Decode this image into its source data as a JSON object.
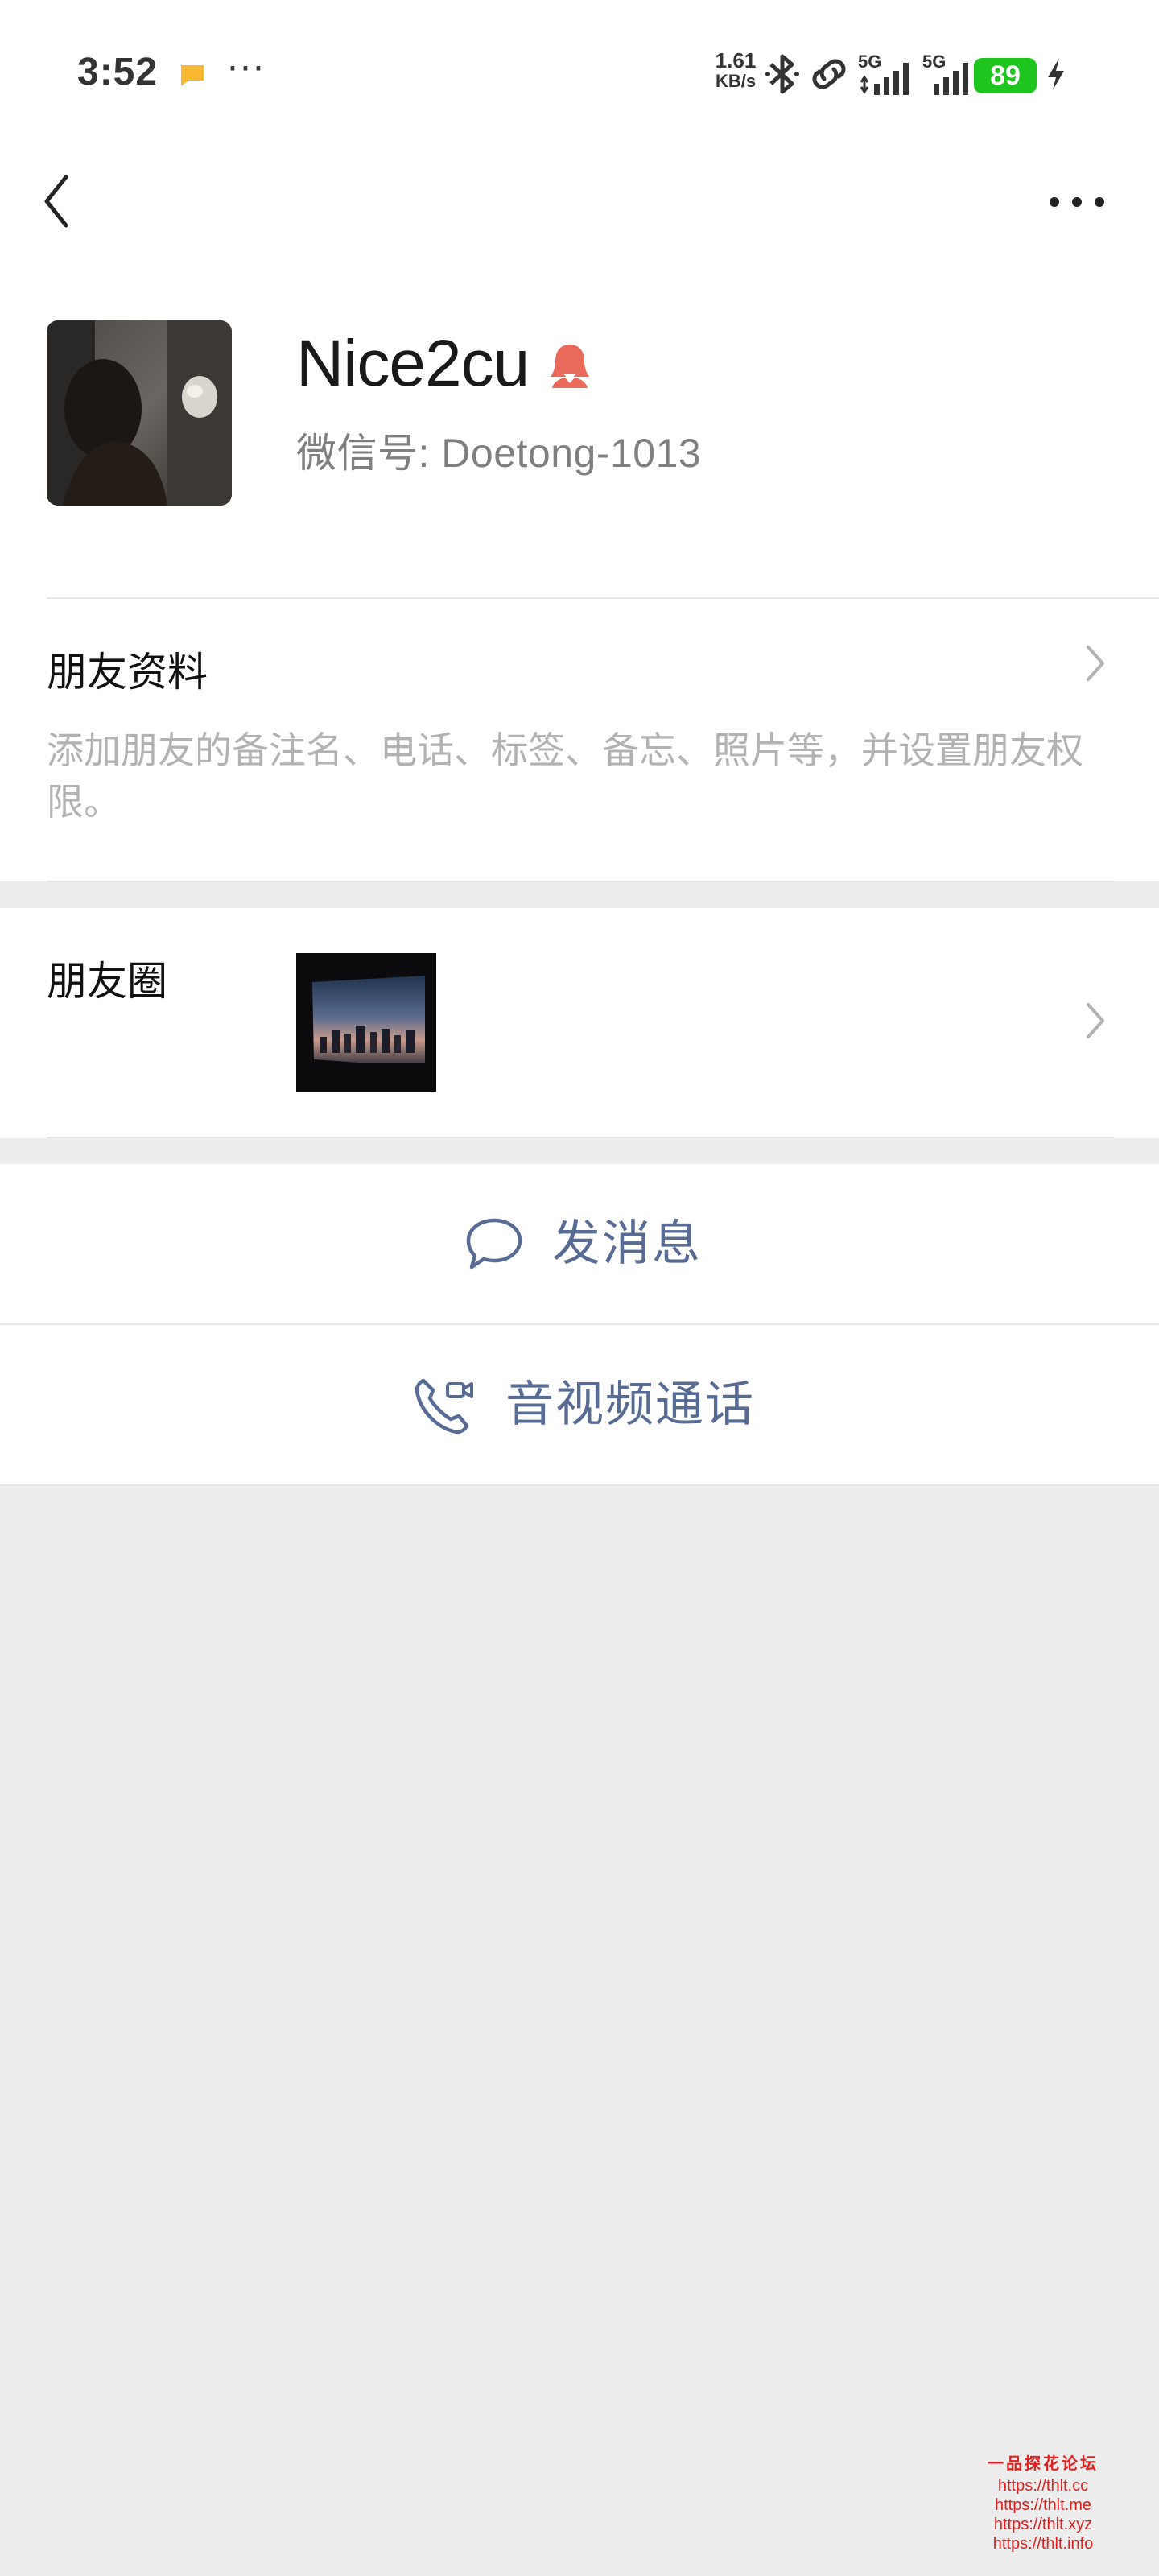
{
  "status_bar": {
    "time": "3:52",
    "more": "···",
    "net_speed_value": "1.61",
    "net_speed_unit": "KB/s",
    "network_1": "5G",
    "network_2": "5G",
    "battery": "89",
    "icons": [
      "notification-flag-icon",
      "bluetooth-icon",
      "link-icon",
      "signal-icon",
      "charging-icon"
    ],
    "battery_color": "#1ec51e"
  },
  "nav": {
    "back_icon": "chevron-left-icon",
    "more_icon": "more-dots-icon"
  },
  "profile": {
    "nickname": "Nice2cu",
    "gender_icon": "female-icon",
    "gender_color": "#e96a5b",
    "wechat_id": "微信号:  Doetong-1013"
  },
  "friend_profile": {
    "title": "朋友资料",
    "description": "添加朋友的备注名、电话、标签、备忘、照片等，并设置朋友权限。"
  },
  "moments": {
    "label": "朋友圈"
  },
  "actions": {
    "send_message": "发消息",
    "av_call": "音视频通话",
    "accent_color": "#576b95"
  },
  "watermark": {
    "title": "一品探花论坛",
    "links": [
      "https://thlt.cc",
      "https://thlt.me",
      "https://thlt.xyz",
      "https://thlt.info"
    ]
  }
}
